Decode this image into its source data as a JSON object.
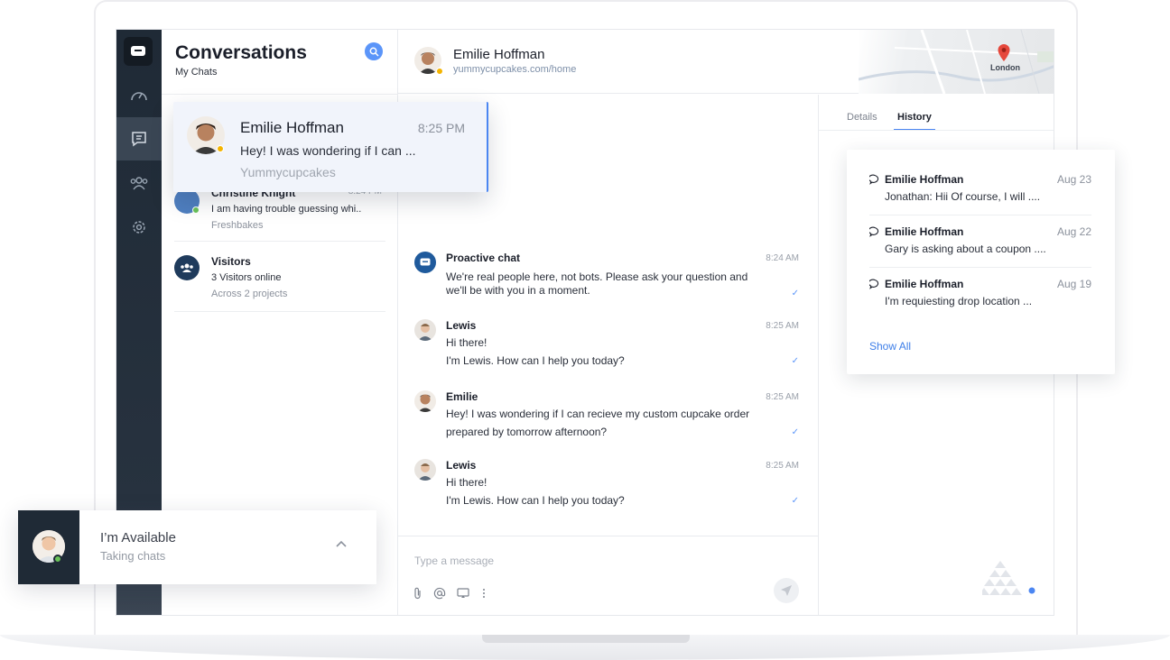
{
  "conversations": {
    "title": "Conversations",
    "subtitle": "My Chats",
    "items": [
      {
        "name": "Christine Knight",
        "message": "I am having trouble guessing whi..",
        "project": "Freshbakes",
        "time": "8:24 PM"
      },
      {
        "name": "Visitors",
        "message": "3 Visitors online",
        "project": "Across 2 projects"
      }
    ]
  },
  "highlighted_conversation": {
    "name": "Emilie Hoffman",
    "time": "8:25 PM",
    "message": "Hey! I was wondering if I can ...",
    "project": "Yummycupcakes"
  },
  "chat_header": {
    "name": "Emilie Hoffman",
    "url": "yummycupcakes.com/home",
    "map_label": "London"
  },
  "messages": [
    {
      "author": "Proactive chat",
      "time": "8:24 AM",
      "lines": [
        "We're real people here, not bots. Please ask your question and",
        "we'll be with you in a moment."
      ]
    },
    {
      "author": "Lewis",
      "time": "8:25 AM",
      "lines": [
        "Hi there!",
        "I'm Lewis. How can I help you today?"
      ]
    },
    {
      "author": "Emilie",
      "time": "8:25 AM",
      "lines": [
        "Hey! I was wondering if I can recieve my custom cupcake order",
        "prepared by tomorrow afternoon?"
      ]
    },
    {
      "author": "Lewis",
      "time": "8:25 AM",
      "lines": [
        "Hi there!",
        "I'm Lewis. How can I help you today?"
      ]
    }
  ],
  "composer": {
    "placeholder": "Type a message"
  },
  "side_panel": {
    "tabs": [
      "Details",
      "History"
    ],
    "active_tab": "History"
  },
  "history": {
    "items": [
      {
        "name": "Emilie Hoffman",
        "date": "Aug 23",
        "snippet": "Jonathan: Hii Of course, I will ...."
      },
      {
        "name": "Emilie Hoffman",
        "date": "Aug 22",
        "snippet": "Gary is asking about a coupon ...."
      },
      {
        "name": "Emilie Hoffman",
        "date": "Aug 19",
        "snippet": "I'm requiesting drop location ..."
      }
    ],
    "show_all": "Show All"
  },
  "availability": {
    "title": "I’m Available",
    "subtitle": "Taking chats"
  },
  "colors": {
    "rail": "#1f2a36",
    "accent": "#4b86f2",
    "online": "#6ac259",
    "away": "#f4b400"
  },
  "icons": [
    "chat-logo-icon",
    "dashboard-icon",
    "conversations-icon",
    "team-icon",
    "settings-icon",
    "search-icon",
    "attachment-icon",
    "mention-icon",
    "screen-share-icon",
    "more-icon",
    "send-icon",
    "chevron-up-icon",
    "speech-bubble-icon",
    "map-pin-icon"
  ]
}
